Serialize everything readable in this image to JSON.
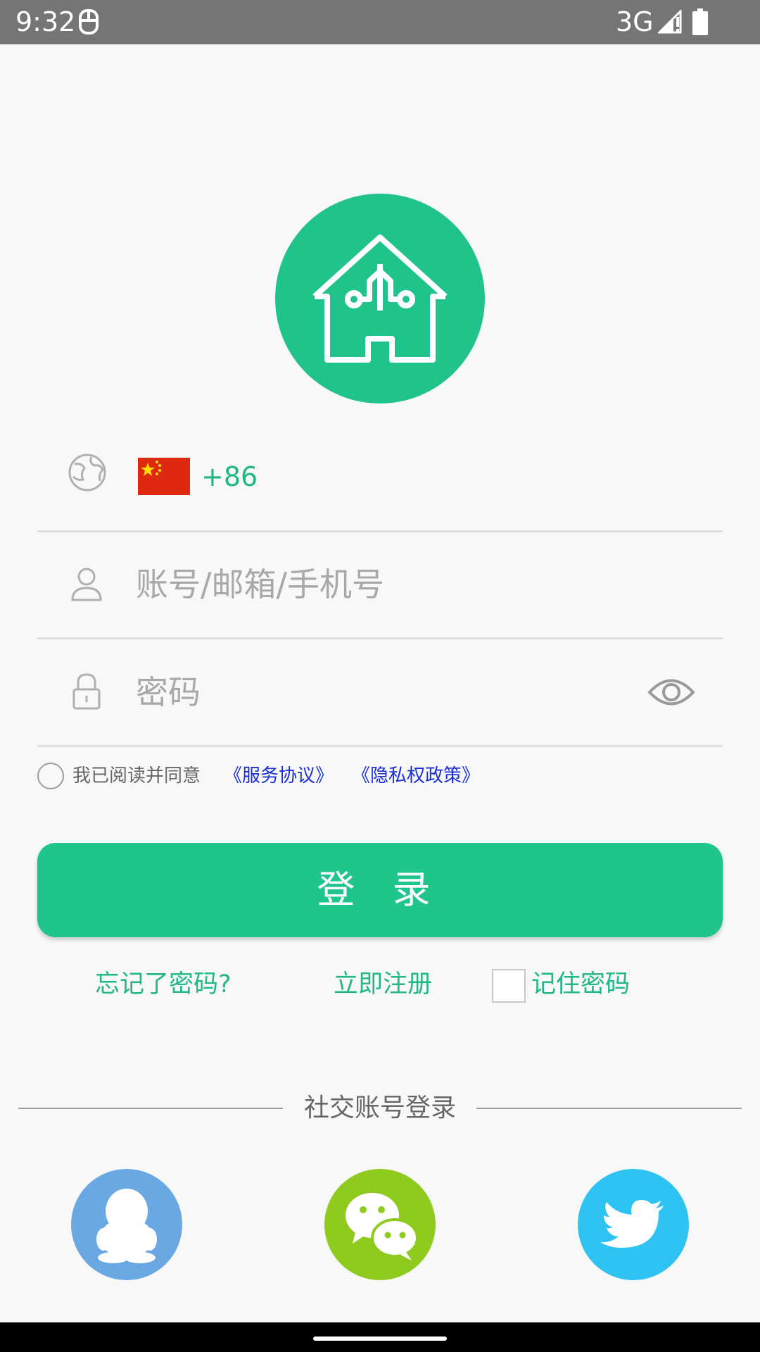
{
  "status_bar": {
    "time": "9:32",
    "network": "3G"
  },
  "login_form": {
    "country_code": "+86",
    "account_placeholder": "账号/邮箱/手机号",
    "password_placeholder": "密码",
    "agreement_prefix": "我已阅读并同意",
    "service_agreement": "《服务协议》",
    "privacy_policy": "《隐私权政策》",
    "login_button": "登 录",
    "forgot_password": "忘记了密码?",
    "register": "立即注册",
    "remember_password": "记住密码"
  },
  "social_login": {
    "title": "社交账号登录",
    "providers": [
      "qq",
      "wechat",
      "twitter"
    ]
  },
  "colors": {
    "brand_green": "#20c48a",
    "qq_blue": "#6aa8e4",
    "wechat_green": "#8fca1f",
    "twitter_blue": "#2fc3f3",
    "link_blue": "#1a2fd6"
  }
}
